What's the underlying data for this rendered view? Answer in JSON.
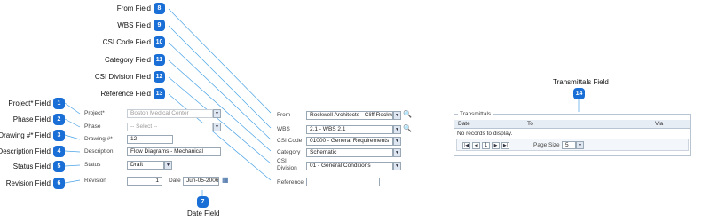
{
  "callouts": {
    "from": {
      "label": "From Field",
      "num": "8"
    },
    "wbs": {
      "label": "WBS Field",
      "num": "9"
    },
    "csi_code": {
      "label": "CSI Code Field",
      "num": "10"
    },
    "category": {
      "label": "Category Field",
      "num": "11"
    },
    "csi_division": {
      "label": "CSI Division Field",
      "num": "12"
    },
    "reference": {
      "label": "Reference Field",
      "num": "13"
    },
    "project": {
      "label": "Project* Field",
      "num": "1"
    },
    "phase": {
      "label": "Phase Field",
      "num": "2"
    },
    "drawing": {
      "label": "Drawing #* Field",
      "num": "3"
    },
    "description": {
      "label": "Description Field",
      "num": "4"
    },
    "status": {
      "label": "Status Field",
      "num": "5"
    },
    "revision": {
      "label": "Revision Field",
      "num": "6"
    },
    "date": {
      "label": "Date Field",
      "num": "7"
    },
    "transmittals": {
      "label": "Transmittals Field",
      "num": "14"
    }
  },
  "form_left": {
    "project": {
      "label": "Project*",
      "value": "Boston Medical Center"
    },
    "phase": {
      "label": "Phase",
      "value": "-- Select --"
    },
    "drawing": {
      "label": "Drawing #*",
      "value": "12"
    },
    "description": {
      "label": "Description",
      "value": "Flow Diagrams - Mechanical"
    },
    "status": {
      "label": "Status",
      "value": "Draft"
    },
    "revision": {
      "label": "Revision",
      "value": "1"
    },
    "date": {
      "label": "Date",
      "value": "Jun-05-2006"
    }
  },
  "form_mid": {
    "from": {
      "label": "From",
      "value": "Rockwell Architects - Cliff Rockwell"
    },
    "wbs": {
      "label": "WBS",
      "value": "2.1 - WBS 2.1"
    },
    "csi_code": {
      "label": "CSI Code",
      "value": "01000 - General Requirements"
    },
    "category": {
      "label": "Category",
      "value": "Schematic"
    },
    "csi_division": {
      "label_line1": "CSI",
      "label_line2": "Division",
      "value": "01 - General Conditions"
    },
    "reference": {
      "label": "Reference",
      "value": ""
    }
  },
  "transmittals": {
    "panel_title": "Transmittals",
    "columns": [
      "Date",
      "To",
      "Via"
    ],
    "empty_text": "No records to display.",
    "page_number": "1",
    "page_size_label": "Page Size",
    "page_size_value": "5"
  },
  "colors": {
    "badge": "#1a6fd6",
    "connector": "#4aa3e6"
  }
}
